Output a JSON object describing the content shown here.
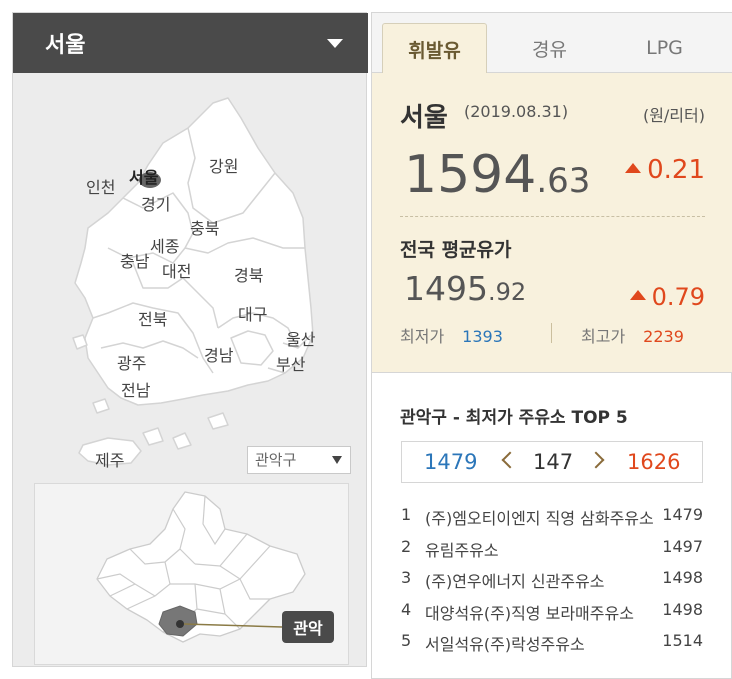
{
  "region": {
    "selected": "서울"
  },
  "map": {
    "provinces": [
      {
        "id": "incheon",
        "label": "인천"
      },
      {
        "id": "seoul",
        "label": "서울"
      },
      {
        "id": "gyeonggi",
        "label": "경기"
      },
      {
        "id": "gangwon",
        "label": "강원"
      },
      {
        "id": "chungbuk",
        "label": "충북"
      },
      {
        "id": "sejong",
        "label": "세종"
      },
      {
        "id": "chungnam",
        "label": "충남"
      },
      {
        "id": "daejeon",
        "label": "대전"
      },
      {
        "id": "gyeongbuk",
        "label": "경북"
      },
      {
        "id": "jeonbuk",
        "label": "전북"
      },
      {
        "id": "daegu",
        "label": "대구"
      },
      {
        "id": "ulsan",
        "label": "울산"
      },
      {
        "id": "gyeongnam",
        "label": "경남"
      },
      {
        "id": "busan",
        "label": "부산"
      },
      {
        "id": "gwangju",
        "label": "광주"
      },
      {
        "id": "jeonnam",
        "label": "전남"
      },
      {
        "id": "jeju",
        "label": "제주"
      }
    ],
    "district_select": "관악구",
    "district_tag": "관악"
  },
  "tabs": [
    {
      "label": "휘발유",
      "active": true
    },
    {
      "label": "경유",
      "active": false
    },
    {
      "label": "LPG",
      "active": false
    }
  ],
  "price": {
    "region": "서울",
    "date": "(2019.08.31)",
    "unit": "(원/리터)",
    "int": "1594",
    "dec": ".63",
    "change": "0.21"
  },
  "national": {
    "title": "전국 평균유가",
    "int": "1495",
    "dec": ".92",
    "change": "0.79",
    "min_label": "최저가",
    "min": "1393",
    "max_label": "최고가",
    "max": "2239"
  },
  "top5": {
    "title": "관악구 - 최저가 주유소 TOP 5",
    "range_min": "1479",
    "range_mid": "147",
    "range_max": "1626",
    "stations": [
      {
        "rank": "1",
        "name": "(주)엠오티이엔지 직영 삼화주유소",
        "price": "1479"
      },
      {
        "rank": "2",
        "name": "유림주유소",
        "price": "1497"
      },
      {
        "rank": "3",
        "name": "(주)연우에너지 신관주유소",
        "price": "1498"
      },
      {
        "rank": "4",
        "name": "대양석유(주)직영 보라매주유소",
        "price": "1498"
      },
      {
        "rank": "5",
        "name": "서일석유(주)락성주유소",
        "price": "1514"
      }
    ]
  },
  "colors": {
    "up": "#e0481d",
    "min": "#2b76b9",
    "tab_active_bg": "#f8f1dd"
  }
}
